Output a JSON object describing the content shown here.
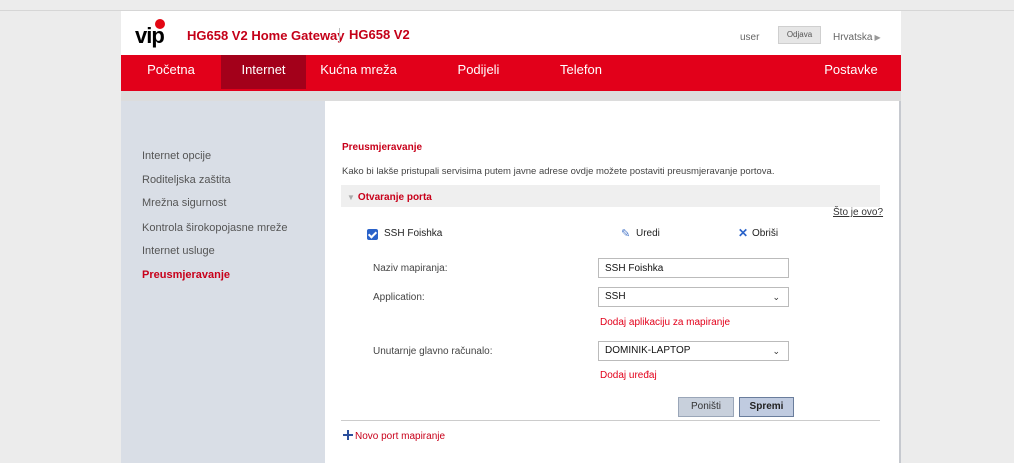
{
  "header": {
    "logo_text": "vip",
    "title": "HG658 V2 Home Gateway",
    "model": "HG658 V2",
    "user_label": "user",
    "logout_label": "Odjava",
    "language": "Hrvatska"
  },
  "nav": {
    "items": [
      {
        "label": "Početna"
      },
      {
        "label": "Internet",
        "active": true
      },
      {
        "label": "Kućna mreža"
      },
      {
        "label": "Podijeli"
      },
      {
        "label": "Telefon"
      },
      {
        "label": "Postavke"
      }
    ]
  },
  "sidebar": {
    "items": [
      {
        "label": "Internet opcije"
      },
      {
        "label": "Roditeljska zaštita"
      },
      {
        "label": "Mrežna sigurnost"
      },
      {
        "label": "Kontrola širokopojasne mreže"
      },
      {
        "label": "Internet usluge"
      },
      {
        "label": "Preusmjeravanje",
        "active": true
      }
    ]
  },
  "main": {
    "title": "Preusmjeravanje",
    "description": "Kako bi lakše pristupali servisima putem javne adrese ovdje možete postaviti preusmjeravanje portova.",
    "section_title": "Otvaranje porta",
    "help_link": "Što je ovo?",
    "rule": {
      "checked": true,
      "name": "SSH Foishka",
      "edit_label": "Uredi",
      "delete_label": "Obriši"
    },
    "form": {
      "mapping_name_label": "Naziv mapiranja:",
      "mapping_name_value": "SSH Foishka",
      "application_label": "Application:",
      "application_value": "SSH",
      "add_application_link": "Dodaj aplikaciju za mapiranje",
      "host_label": "Unutarnje glavno računalo:",
      "host_value": "DOMINIK-LAPTOP",
      "add_device_link": "Dodaj uređaj",
      "reset_label": "Poništi",
      "save_label": "Spremi"
    },
    "new_mapping_link": "Novo port mapiranje"
  },
  "colors": {
    "brand_red": "#e2001a",
    "nav_active": "#a3001a",
    "sidebar_bg": "#d9dee6",
    "link_blue": "#2a62c9"
  }
}
